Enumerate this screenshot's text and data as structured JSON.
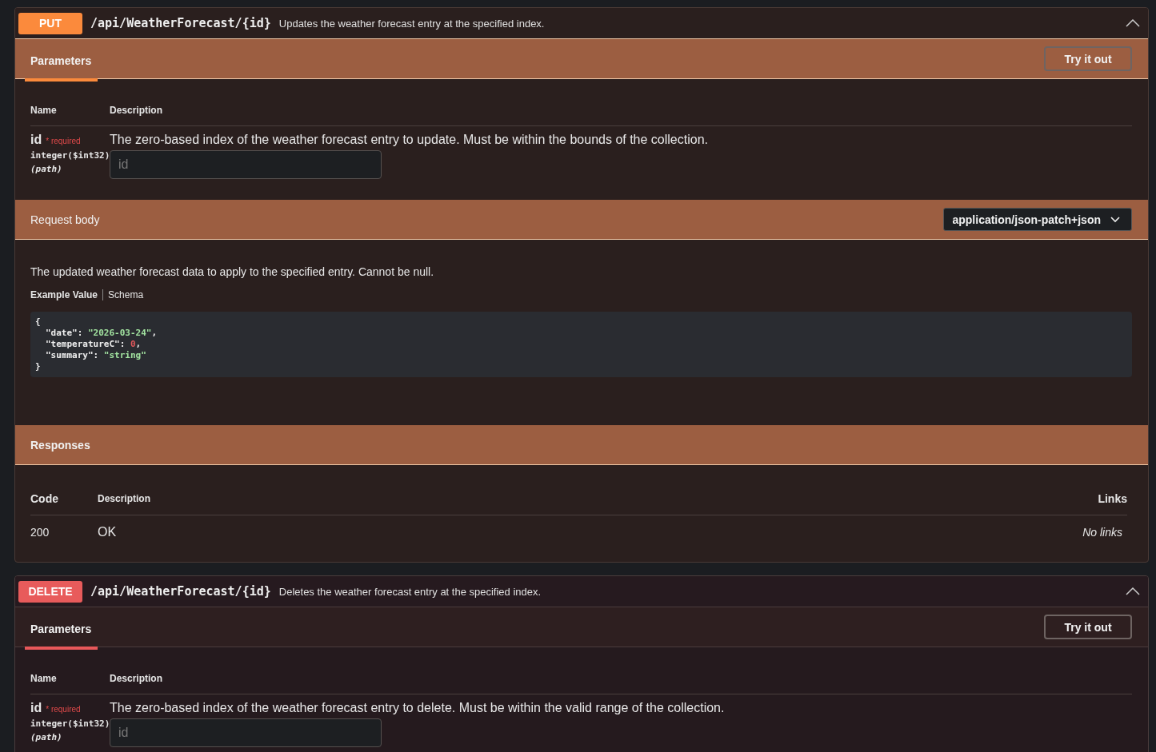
{
  "operations": [
    {
      "method": "PUT",
      "kind": "put",
      "path": "/api/WeatherForecast/{id}",
      "summary": "Updates the weather forecast entry at the specified index.",
      "expanded": true,
      "tab": {
        "label": "Parameters",
        "selected": true
      },
      "try_button": "Try it out",
      "param_columns": [
        "Name",
        "Description"
      ],
      "parameters": [
        {
          "name": "id",
          "required_mark": "*",
          "required": "required",
          "type": "integer($int32)",
          "location": "(path)",
          "description": "The zero-based index of the weather forecast entry to update. Must be within the bounds of the collection.",
          "placeholder": "id"
        }
      ],
      "request_body": {
        "title": "Request body",
        "content_type": "application/json-patch+json",
        "description": "The updated weather forecast data to apply to the specified entry. Cannot be null.",
        "tabs": [
          {
            "label": "Example Value",
            "selected": true
          },
          {
            "label": "Schema",
            "selected": false
          }
        ],
        "example": {
          "open": "{",
          "close": "}",
          "fields": [
            {
              "key": "\"date\"",
              "sep": ": ",
              "value": "\"2026-03-24\"",
              "kind": "string",
              "punct": ","
            },
            {
              "key": "\"temperatureC\"",
              "sep": ": ",
              "value": "0",
              "kind": "number",
              "punct": ","
            },
            {
              "key": "\"summary\"",
              "sep": ": ",
              "value": "\"string\"",
              "kind": "string"
            }
          ]
        }
      },
      "responses": {
        "title": "Responses",
        "columns": [
          "Code",
          "Description",
          "Links"
        ],
        "rows": [
          {
            "code": "200",
            "description": "OK",
            "links": "No links"
          }
        ]
      }
    },
    {
      "method": "DELETE",
      "kind": "delete",
      "path": "/api/WeatherForecast/{id}",
      "summary": "Deletes the weather forecast entry at the specified index.",
      "expanded": true,
      "tab": {
        "label": "Parameters",
        "selected": true
      },
      "try_button": "Try it out",
      "param_columns": [
        "Name",
        "Description"
      ],
      "parameters": [
        {
          "name": "id",
          "required_mark": "*",
          "required": "required",
          "type": "integer($int32)",
          "location": "(path)",
          "description": "The zero-based index of the weather forecast entry to delete. Must be within the valid range of the collection.",
          "placeholder": "id"
        }
      ]
    }
  ]
}
